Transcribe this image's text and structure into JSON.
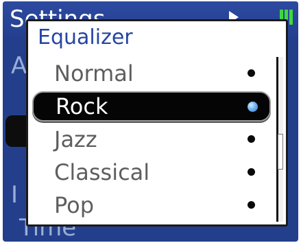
{
  "background_screen": {
    "header_title": "Settings",
    "faded_rows": [
      "A",
      "I",
      "Time"
    ],
    "status_icons": [
      "play-icon",
      "battery-icon"
    ]
  },
  "equalizer_popup": {
    "title": "Equalizer",
    "items": [
      {
        "label": "Normal",
        "selected": false
      },
      {
        "label": "Rock",
        "selected": true
      },
      {
        "label": "Jazz",
        "selected": false
      },
      {
        "label": "Classical",
        "selected": false
      },
      {
        "label": "Pop",
        "selected": false
      }
    ]
  },
  "colors": {
    "background_blue": "#233f8c",
    "popup_title": "#2545a3",
    "selected_bg": "#050505",
    "selected_dot": "#6fb4f0",
    "battery_green": "#40d840"
  }
}
